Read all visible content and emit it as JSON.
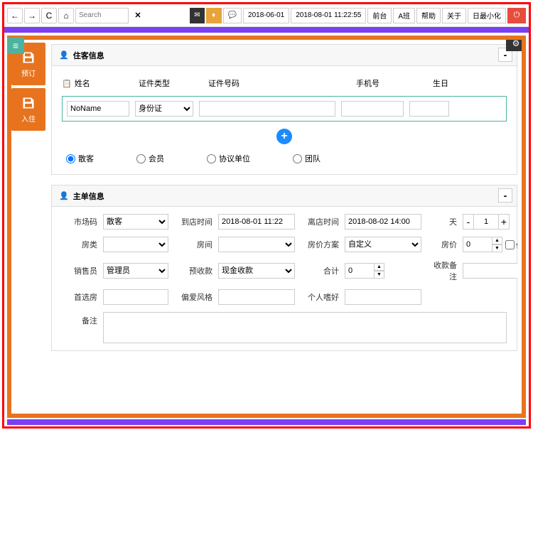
{
  "topbar": {
    "search_placeholder": "Search",
    "date1": "2018-06-01",
    "date2": "2018-08-01 11:22:55",
    "front": "前台",
    "shift": "A班",
    "help": "帮助",
    "about": "关于",
    "minimize": "日最小化"
  },
  "sidebar": {
    "reserve": "预订",
    "checkin": "入住"
  },
  "guest_panel": {
    "title": "住客信息",
    "headers": {
      "name": "姓名",
      "idtype": "证件类型",
      "idno": "证件号码",
      "phone": "手机号",
      "birthday": "生日"
    },
    "row": {
      "name": "NoName",
      "idtype": "身份证"
    },
    "radios": {
      "guest": "散客",
      "member": "会员",
      "agreement": "协议单位",
      "group": "团队"
    }
  },
  "order_panel": {
    "title": "主单信息",
    "labels": {
      "market": "市场码",
      "arrive": "到店时间",
      "leave": "离店时间",
      "days": "天",
      "roomtype": "房类",
      "room": "房间",
      "priceplan": "房价方案",
      "price": "房价",
      "secret": "保密",
      "seller": "销售员",
      "prepay": "预收款",
      "total": "合计",
      "payremark": "收款备注",
      "prefroom": "首选房",
      "style": "偏爱风格",
      "hobby": "个人嗜好",
      "remark": "备注"
    },
    "values": {
      "market": "散客",
      "arrive": "2018-08-01 11:22",
      "leave": "2018-08-02 14:00",
      "days": "1",
      "priceplan": "自定义",
      "price": "0",
      "seller": "管理员",
      "prepay": "现金收款",
      "total": "0"
    }
  }
}
